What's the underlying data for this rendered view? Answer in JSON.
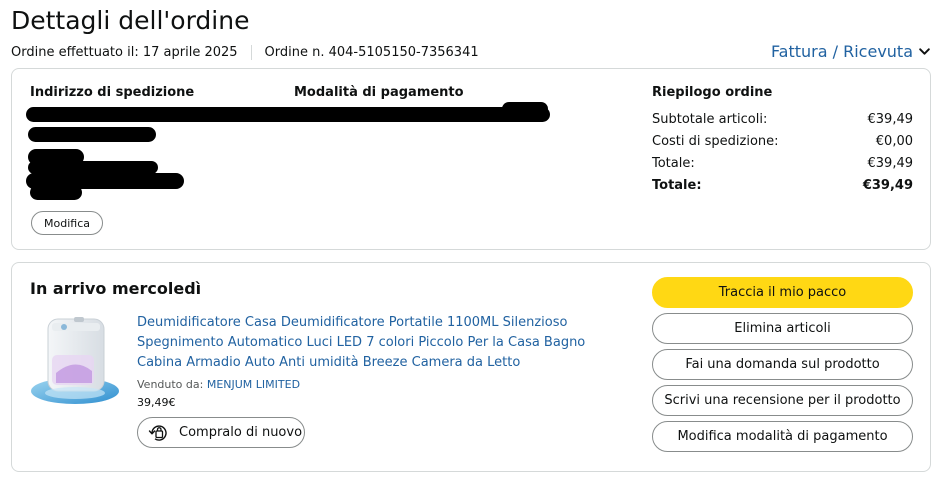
{
  "header": {
    "title": "Dettagli dell'ordine",
    "order_date": "Ordine effettuato il: 17 aprile 2025",
    "order_number": "Ordine n. 404-5105150-7356341",
    "invoice_link": "Fattura / Ricevuta"
  },
  "shipping": {
    "address_title": "Indirizzo di spedizione",
    "payment_title": "Modalità di pagamento",
    "modify_label": "Modifica"
  },
  "summary": {
    "title": "Riepilogo ordine",
    "rows": [
      {
        "label": "Subtotale articoli:",
        "value": "€39,49"
      },
      {
        "label": "Costi di spedizione:",
        "value": "€0,00"
      },
      {
        "label": "Totale:",
        "value": "€39,49"
      },
      {
        "label": "Totale:",
        "value": "€39,49"
      }
    ]
  },
  "delivery": {
    "title": "In arrivo mercoledì",
    "product": {
      "name": "Deumidificatore Casa Deumidificatore Portatile 1100ML Silenzioso Spegnimento Automatico Luci LED 7 colori Piccolo Per la Casa Bagno Cabina Armadio Auto Anti umidità Breeze Camera da Letto",
      "seller_prefix": "Venduto da:",
      "seller_name": "MENJUM LIMITED",
      "price": "39,49€",
      "rebuy_label": "Compralo di nuovo"
    },
    "actions": [
      "Traccia il mio pacco",
      "Elimina articoli",
      "Fai una domanda sul prodotto",
      "Scrivi una recensione per il prodotto",
      "Modifica modalità di pagamento"
    ]
  },
  "colors": {
    "link": "#2162a1",
    "primary_button": "#ffd814",
    "border": "#d5d9d9"
  }
}
